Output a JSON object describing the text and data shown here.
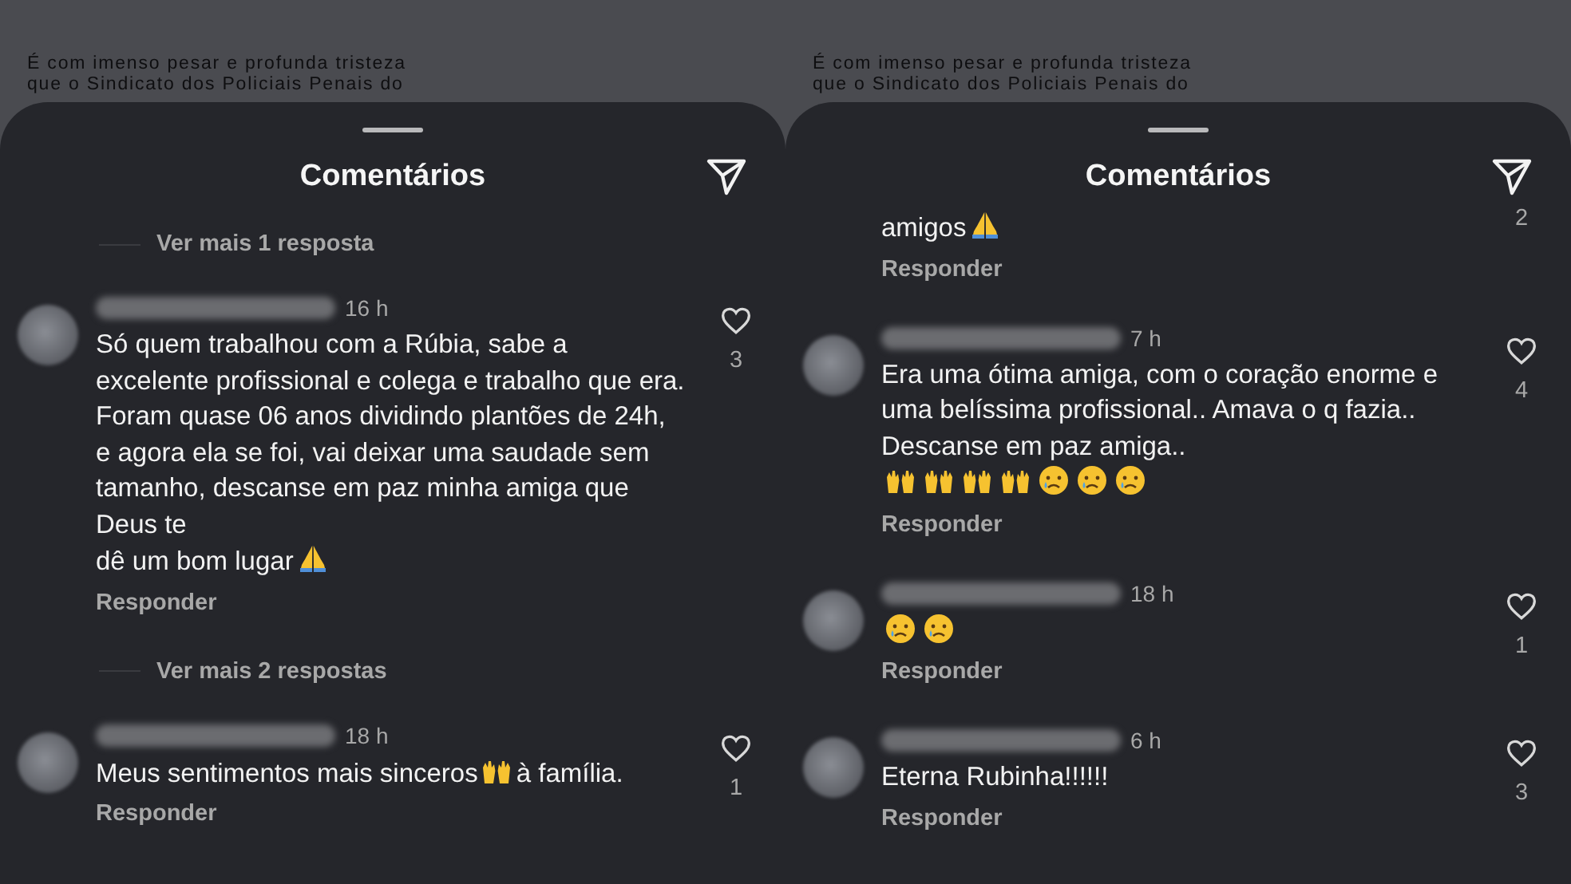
{
  "panels": [
    {
      "caption_lines": [
        "É com imenso pesar e profunda tristeza",
        "que o Sindicato dos Policiais Penais do"
      ],
      "title": "Comentários",
      "items": [
        {
          "kind": "more-replies",
          "label": "Ver mais 1 resposta"
        },
        {
          "kind": "comment",
          "time": "16 h",
          "parts": [
            {
              "kind": "paragraph",
              "text": "Só quem trabalhou com a Rúbia, sabe a excelente profissional e colega e trabalho que era. Foram quase 06 anos dividindo plantões de 24h, e agora ela se foi, vai deixar uma saudade sem tamanho, descanse em paz minha amiga que Deus te"
            },
            {
              "kind": "text",
              "text": "dê um bom lugar"
            },
            {
              "kind": "pray"
            }
          ],
          "reply": "Responder",
          "likes": "3"
        },
        {
          "kind": "more-replies",
          "label": "Ver mais 2 respostas"
        },
        {
          "kind": "comment",
          "time": "18 h",
          "parts": [
            {
              "kind": "text",
              "text": "Meus sentimentos mais sinceros"
            },
            {
              "kind": "raised-hands"
            },
            {
              "kind": "text",
              "text": "à família."
            }
          ],
          "reply": "Responder",
          "likes": "1"
        }
      ]
    },
    {
      "caption_lines": [
        "É com imenso pesar e profunda tristeza",
        "que o Sindicato dos Policiais Penais do"
      ],
      "title": "Comentários",
      "items": [
        {
          "kind": "comment-tail",
          "parts": [
            {
              "kind": "text",
              "text": "amigos"
            },
            {
              "kind": "pray"
            }
          ],
          "reply": "Responder",
          "likes": "2"
        },
        {
          "kind": "comment",
          "time": "7 h",
          "parts": [
            {
              "kind": "paragraph",
              "text": "Era uma ótima amiga, com o coração enorme e uma belíssima profissional.. Amava o q fazia.. Descanse em paz amiga.."
            },
            {
              "kind": "raised-hands"
            },
            {
              "kind": "raised-hands"
            },
            {
              "kind": "raised-hands"
            },
            {
              "kind": "raised-hands"
            },
            {
              "kind": "crying"
            },
            {
              "kind": "crying"
            },
            {
              "kind": "crying"
            }
          ],
          "reply": "Responder",
          "likes": "4"
        },
        {
          "kind": "comment",
          "time": "18 h",
          "parts": [
            {
              "kind": "crying"
            },
            {
              "kind": "crying"
            }
          ],
          "reply": "Responder",
          "likes": "1"
        },
        {
          "kind": "comment",
          "time": "6 h",
          "parts": [
            {
              "kind": "text",
              "text": "Eterna Rubinha!!!!!!"
            }
          ],
          "reply": "Responder",
          "likes": "3"
        }
      ]
    }
  ]
}
